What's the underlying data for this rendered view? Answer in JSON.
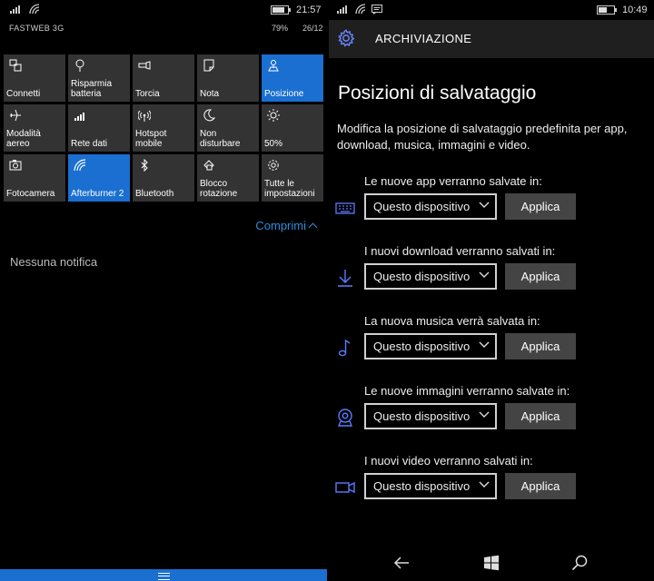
{
  "left_panel": {
    "status": {
      "time": "21:57",
      "carrier": "FASTWEB 3G",
      "battery_pct": "79%",
      "date": "26/12",
      "battery_level": 0.79
    },
    "tiles": [
      {
        "label": "Connetti",
        "icon": "connect-icon",
        "active": false
      },
      {
        "label": "Risparmia batteria",
        "icon": "battery-saver-icon",
        "active": false
      },
      {
        "label": "Torcia",
        "icon": "flashlight-icon",
        "active": false
      },
      {
        "label": "Nota",
        "icon": "note-icon",
        "active": false
      },
      {
        "label": "Posizione",
        "icon": "location-icon",
        "active": true
      },
      {
        "label": "Modalità aereo",
        "icon": "airplane-icon",
        "active": false
      },
      {
        "label": "Rete dati",
        "icon": "signal-icon",
        "active": false
      },
      {
        "label": "Hotspot mobile",
        "icon": "hotspot-icon",
        "active": false
      },
      {
        "label": "Non disturbare",
        "icon": "moon-icon",
        "active": false
      },
      {
        "label": "50%",
        "icon": "brightness-icon",
        "active": false
      },
      {
        "label": "Fotocamera",
        "icon": "camera-icon",
        "active": false
      },
      {
        "label": "Afterburner 2",
        "icon": "wifi-icon",
        "active": true
      },
      {
        "label": "Bluetooth",
        "icon": "bluetooth-icon",
        "active": false
      },
      {
        "label": "Blocco rotazione",
        "icon": "rotation-lock-icon",
        "active": false
      },
      {
        "label": "Tutte le impostazioni",
        "icon": "gear-icon",
        "active": false
      }
    ],
    "collapse_label": "Comprimi",
    "no_notifications": "Nessuna notifica"
  },
  "right_panel": {
    "status": {
      "time": "10:49",
      "battery_level": 0.55
    },
    "header_title": "ARCHIVIAZIONE",
    "page_title": "Posizioni di salvataggio",
    "description": "Modifica la posizione di salvataggio predefinita per app, download, musica, immagini e video.",
    "rows": [
      {
        "label": "Le nuove app verranno salvate in:",
        "icon": "keyboard-icon",
        "value": "Questo dispositivo",
        "button": "Applica"
      },
      {
        "label": "I nuovi download verranno salvati in:",
        "icon": "download-icon",
        "value": "Questo dispositivo",
        "button": "Applica"
      },
      {
        "label": "La nuova musica verrà salvata in:",
        "icon": "music-note-icon",
        "value": "Questo dispositivo",
        "button": "Applica"
      },
      {
        "label": "Le nuove immagini verranno salvate in:",
        "icon": "webcam-icon",
        "value": "Questo dispositivo",
        "button": "Applica"
      },
      {
        "label": "I nuovi video verranno salvati in:",
        "icon": "video-camera-icon",
        "value": "Questo dispositivo",
        "button": "Applica"
      }
    ]
  },
  "colors": {
    "accent": "#1a6fd1",
    "link": "#2e8de0",
    "tile": "#333333",
    "header": "#1f1f1f",
    "row_icon": "#5a7cff"
  }
}
